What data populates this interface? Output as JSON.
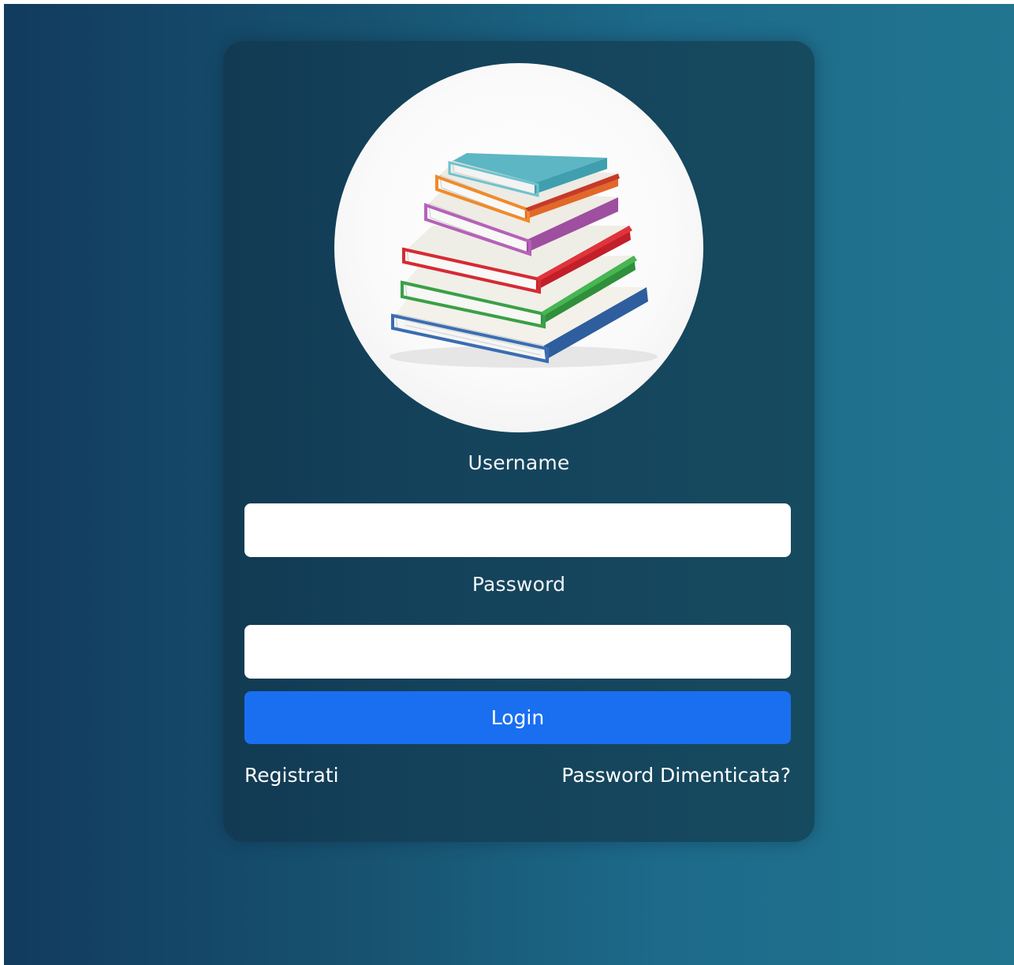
{
  "login_form": {
    "username_label": "Username",
    "username_value": "",
    "password_label": "Password",
    "password_value": "",
    "login_label": "Login",
    "register_label": "Registrati",
    "forgot_password_label": "Password Dimenticata?"
  },
  "logo": {
    "icon": "stack-of-books-icon"
  },
  "colors": {
    "background_gradient_start": "#123b5e",
    "background_gradient_end": "#21758f",
    "card_background": "#14425b",
    "login_button": "#1a6ff0",
    "text": "#ffffff"
  }
}
